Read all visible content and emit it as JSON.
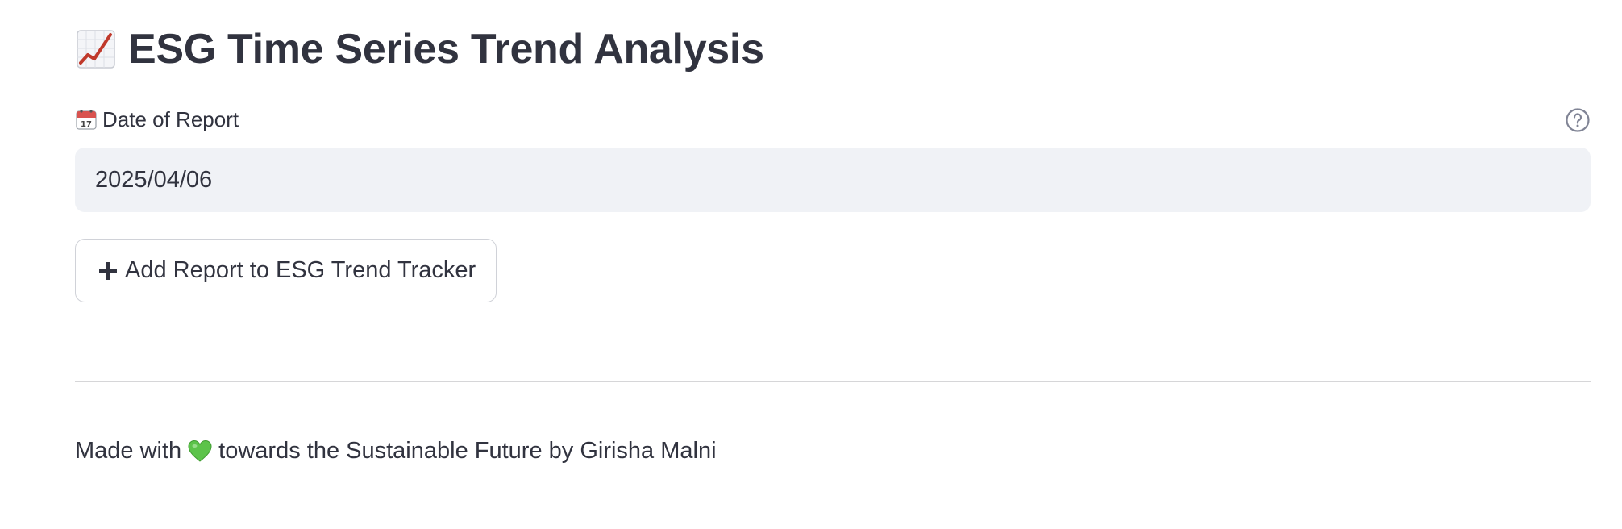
{
  "header": {
    "title": "ESG Time Series Trend Analysis",
    "title_icon": "chart-increasing-icon"
  },
  "date_field": {
    "label": "Date of Report",
    "label_icon": "calendar-icon",
    "value": "2025/04/06",
    "help_icon": "help-circle-icon"
  },
  "actions": {
    "add_button_label": "Add Report to ESG Trend Tracker",
    "add_button_icon": "plus-icon"
  },
  "footer": {
    "prefix": "Made with",
    "heart_icon": "green-heart-icon",
    "suffix": "towards the Sustainable Future by Girisha Malni"
  },
  "colors": {
    "text": "#31333f",
    "input_bg": "#f0f2f6",
    "border": "#d0d2d8",
    "heart": "#5cc34a",
    "chart_line": "#c0392b"
  }
}
